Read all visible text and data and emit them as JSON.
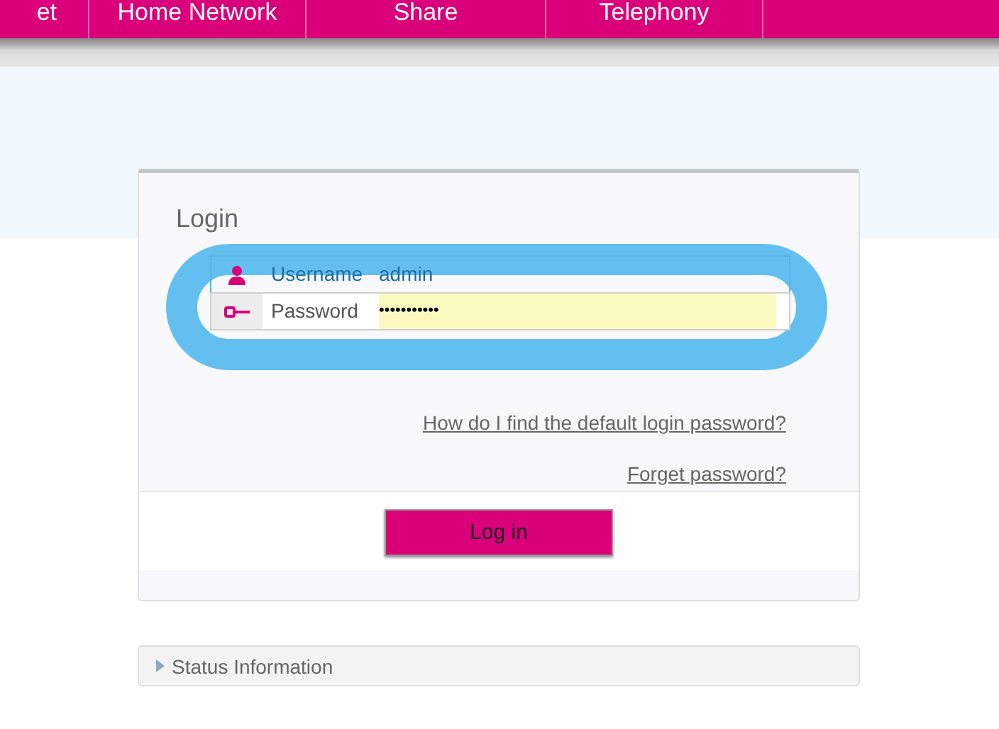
{
  "nav": {
    "tabs": [
      {
        "label": "et"
      },
      {
        "label": "Home Network"
      },
      {
        "label": "Share"
      },
      {
        "label": "Telephony"
      }
    ]
  },
  "login": {
    "title": "Login",
    "fields": [
      {
        "kind": "user",
        "label": "Username",
        "value": "admin"
      },
      {
        "kind": "key",
        "label": "Password",
        "value": "•••••••••••"
      }
    ],
    "links": [
      "How do I find the default login password?",
      "Forget password?"
    ],
    "button": "Log in"
  },
  "status": {
    "label": "Status Information",
    "expanded": false
  }
}
